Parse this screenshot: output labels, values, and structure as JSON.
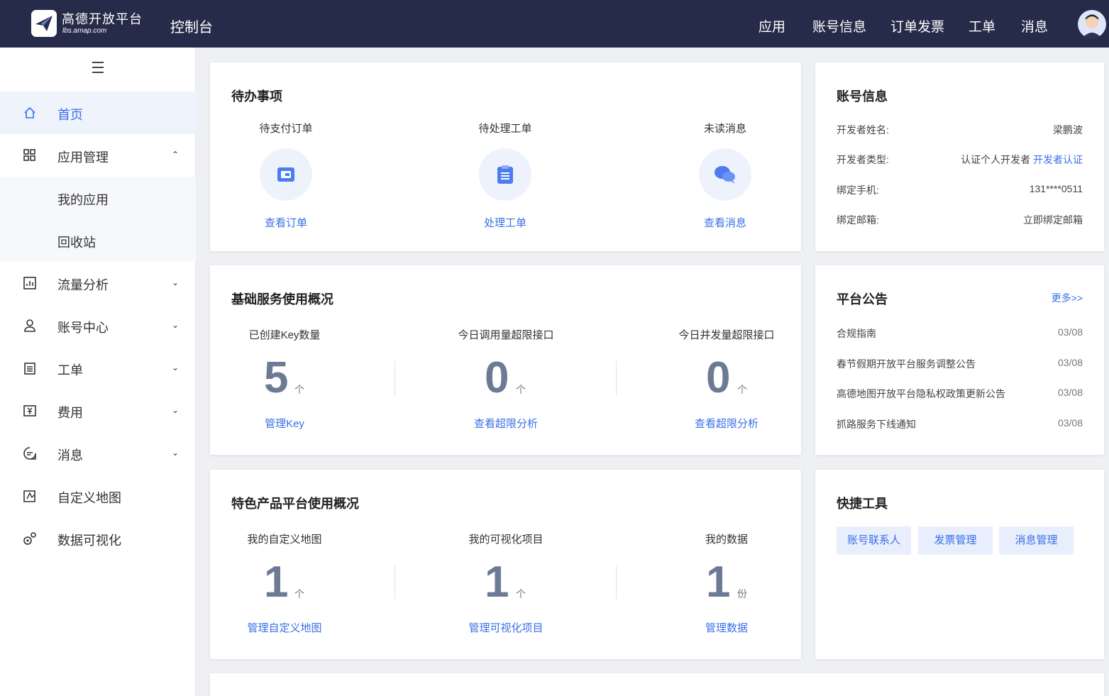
{
  "header": {
    "logo_text": "高德开放平台",
    "logo_sub": "lbs.amap.com",
    "console": "控制台",
    "nav": [
      "应用",
      "账号信息",
      "订单发票",
      "工单",
      "消息"
    ]
  },
  "sidebar": {
    "items": [
      {
        "label": "首页",
        "icon": "home-icon"
      },
      {
        "label": "应用管理",
        "icon": "apps-icon",
        "chevron": "up"
      },
      {
        "label": "我的应用"
      },
      {
        "label": "回收站"
      },
      {
        "label": "流量分析",
        "icon": "chart-icon",
        "chevron": "down"
      },
      {
        "label": "账号中心",
        "icon": "user-icon",
        "chevron": "down"
      },
      {
        "label": "工单",
        "icon": "ticket-icon",
        "chevron": "down"
      },
      {
        "label": "费用",
        "icon": "fee-icon",
        "chevron": "down"
      },
      {
        "label": "消息",
        "icon": "message-icon",
        "chevron": "down"
      },
      {
        "label": "自定义地图",
        "icon": "map-icon"
      },
      {
        "label": "数据可视化",
        "icon": "visual-icon"
      }
    ]
  },
  "todo": {
    "title": "待办事项",
    "items": [
      {
        "label": "待支付订单",
        "link": "查看订单",
        "icon": "wallet-icon"
      },
      {
        "label": "待处理工单",
        "link": "处理工单",
        "icon": "clipboard-icon"
      },
      {
        "label": "未读消息",
        "link": "查看消息",
        "icon": "chat-icon"
      }
    ]
  },
  "account": {
    "title": "账号信息",
    "rows": [
      {
        "label": "开发者姓名:",
        "value": "梁鹏波"
      },
      {
        "label": "开发者类型:",
        "value": "认证个人开发者",
        "link": "开发者认证"
      },
      {
        "label": "绑定手机:",
        "value": "131****0511"
      },
      {
        "label": "绑定邮箱:",
        "link": "立即绑定邮箱"
      }
    ]
  },
  "basic": {
    "title": "基础服务使用概况",
    "items": [
      {
        "label": "已创建Key数量",
        "value": "5",
        "unit": "个",
        "link": "管理Key"
      },
      {
        "label": "今日调用量超限接口",
        "value": "0",
        "unit": "个",
        "link": "查看超限分析"
      },
      {
        "label": "今日并发量超限接口",
        "value": "0",
        "unit": "个",
        "link": "查看超限分析"
      }
    ]
  },
  "notice": {
    "title": "平台公告",
    "more": "更多>>",
    "items": [
      {
        "text": "合规指南",
        "date": "03/08"
      },
      {
        "text": "春节假期开放平台服务调整公告",
        "date": "03/08"
      },
      {
        "text": "高德地图开放平台隐私权政策更新公告",
        "date": "03/08"
      },
      {
        "text": "抓路服务下线通知",
        "date": "03/08"
      }
    ]
  },
  "featured": {
    "title": "特色产品平台使用概况",
    "items": [
      {
        "label": "我的自定义地图",
        "value": "1",
        "unit": "个",
        "link": "管理自定义地图"
      },
      {
        "label": "我的可视化项目",
        "value": "1",
        "unit": "个",
        "link": "管理可视化项目"
      },
      {
        "label": "我的数据",
        "value": "1",
        "unit": "份",
        "link": "管理数据"
      }
    ]
  },
  "tools": {
    "title": "快捷工具",
    "buttons": [
      "账号联系人",
      "发票管理",
      "消息管理"
    ]
  },
  "colors": {
    "header_bg": "#262b4a",
    "accent": "#3a6fe8",
    "number": "#6c7a96"
  }
}
